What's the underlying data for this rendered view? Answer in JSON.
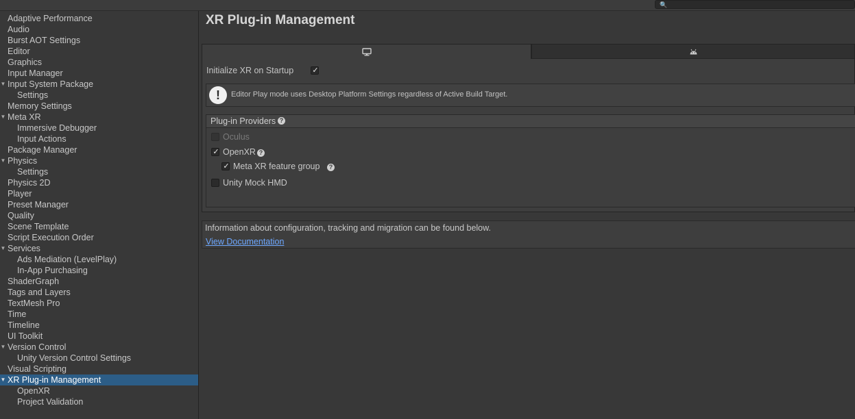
{
  "toolbar": {
    "search_icon": "magnifier-icon",
    "search_value": ""
  },
  "sidebar": {
    "items": [
      {
        "label": "Adaptive Performance",
        "level": 0
      },
      {
        "label": "Audio",
        "level": 0
      },
      {
        "label": "Burst AOT Settings",
        "level": 0
      },
      {
        "label": "Editor",
        "level": 0
      },
      {
        "label": "Graphics",
        "level": 0
      },
      {
        "label": "Input Manager",
        "level": 0
      },
      {
        "label": "Input System Package",
        "level": 0,
        "expanded": true
      },
      {
        "label": "Settings",
        "level": 1
      },
      {
        "label": "Memory Settings",
        "level": 0
      },
      {
        "label": "Meta XR",
        "level": 0,
        "expanded": true
      },
      {
        "label": "Immersive Debugger",
        "level": 1
      },
      {
        "label": "Input Actions",
        "level": 1
      },
      {
        "label": "Package Manager",
        "level": 0
      },
      {
        "label": "Physics",
        "level": 0,
        "expanded": true
      },
      {
        "label": "Settings",
        "level": 1
      },
      {
        "label": "Physics 2D",
        "level": 0
      },
      {
        "label": "Player",
        "level": 0
      },
      {
        "label": "Preset Manager",
        "level": 0
      },
      {
        "label": "Quality",
        "level": 0
      },
      {
        "label": "Scene Template",
        "level": 0
      },
      {
        "label": "Script Execution Order",
        "level": 0
      },
      {
        "label": "Services",
        "level": 0,
        "expanded": true
      },
      {
        "label": "Ads Mediation (LevelPlay)",
        "level": 1
      },
      {
        "label": "In-App Purchasing",
        "level": 1
      },
      {
        "label": "ShaderGraph",
        "level": 0
      },
      {
        "label": "Tags and Layers",
        "level": 0
      },
      {
        "label": "TextMesh Pro",
        "level": 0
      },
      {
        "label": "Time",
        "level": 0
      },
      {
        "label": "Timeline",
        "level": 0
      },
      {
        "label": "UI Toolkit",
        "level": 0
      },
      {
        "label": "Version Control",
        "level": 0,
        "expanded": true
      },
      {
        "label": "Unity Version Control Settings",
        "level": 1
      },
      {
        "label": "Visual Scripting",
        "level": 0
      },
      {
        "label": "XR Plug-in Management",
        "level": 0,
        "expanded": true,
        "selected": true
      },
      {
        "label": "OpenXR",
        "level": 1
      },
      {
        "label": "Project Validation",
        "level": 1
      }
    ],
    "selected_color": "#2c5d87"
  },
  "main": {
    "title": "XR Plug-in Management",
    "tabs": [
      {
        "icon": "desktop-monitor-icon",
        "active": true
      },
      {
        "icon": "android-icon",
        "active": false
      }
    ],
    "init_on_startup": {
      "label": "Initialize XR on Startup",
      "checked": true
    },
    "help_box": {
      "icon": "exclamation-icon",
      "text": "Editor Play mode uses Desktop Platform Settings regardless of Active Build Target."
    },
    "providers": {
      "title": "Plug-in Providers",
      "items": [
        {
          "label": "Oculus",
          "checked": false,
          "disabled": true
        },
        {
          "label": "OpenXR",
          "checked": true,
          "help": true
        },
        {
          "label": "Meta XR feature group",
          "checked": true,
          "help": true,
          "child": true
        },
        {
          "label": "Unity Mock HMD",
          "checked": false
        }
      ]
    },
    "info": {
      "text": "Information about configuration, tracking and migration can be found below.",
      "link": "View Documentation"
    },
    "link_color": "#6ea8ff"
  }
}
